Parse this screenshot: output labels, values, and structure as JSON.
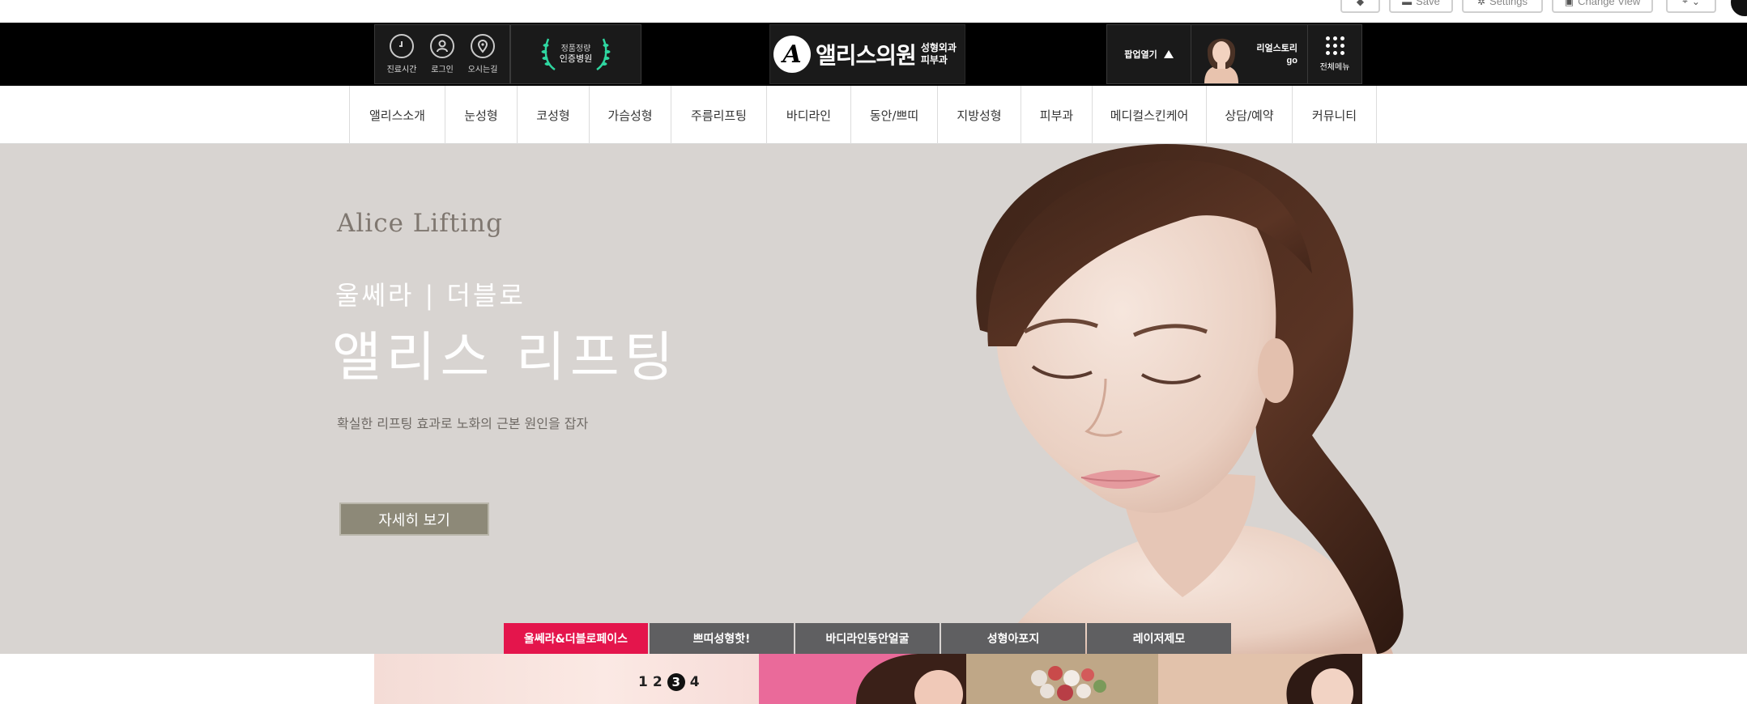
{
  "toolbar": {
    "items": [
      {
        "icon": "diamond-icon",
        "label": ""
      },
      {
        "icon": "save-icon",
        "label": "Save"
      },
      {
        "icon": "gear-icon",
        "label": "Settings"
      },
      {
        "icon": "view-icon",
        "label": "Change View"
      },
      {
        "icon": "pin-icon",
        "label": ""
      }
    ]
  },
  "header": {
    "utilities": [
      {
        "icon": "clock-icon",
        "label": "진료시간"
      },
      {
        "icon": "user-icon",
        "label": "로그인"
      },
      {
        "icon": "location-pin-icon",
        "label": "오시는길"
      }
    ],
    "cert": {
      "line1": "정품정량",
      "line2": "인증병원"
    },
    "logo": {
      "mark": "A",
      "name": "앨리스의원",
      "sub1": "성형외과",
      "sub2": "피부과"
    },
    "popup_toggle": "팝업열기",
    "story": {
      "line1": "리얼스토리",
      "line2": "go"
    },
    "all_menu": "전체메뉴"
  },
  "nav": {
    "items": [
      "앨리스소개",
      "눈성형",
      "코성형",
      "가슴성형",
      "주름리프팅",
      "바디라인",
      "동안/쁘띠",
      "지방성형",
      "피부과",
      "메디컬스킨케어",
      "상담/예약",
      "커뮤니티"
    ]
  },
  "hero": {
    "eyebrow": "Alice Lifting",
    "subtitle": "울쎄라 | 더블로",
    "title": "앨리스 리프팅",
    "description": "확실한 리프팅 효과로 노화의 근본 원인을 잡자",
    "button": "자세히 보기",
    "tabs": [
      "울쎄라&더블로페이스",
      "쁘띠성형핫!",
      "바디라인동안얼굴",
      "성형아포지",
      "레이저제모"
    ],
    "active_tab": 0
  },
  "banners": {
    "pager": [
      "1",
      "2",
      "3",
      "4"
    ],
    "current_page": 3
  },
  "colors": {
    "header_bg": "#000000",
    "hero_bg": "#d8d4d1",
    "accent": "#e4154c",
    "tab_bg": "#5f5f61",
    "button_bg": "#8d8978"
  }
}
